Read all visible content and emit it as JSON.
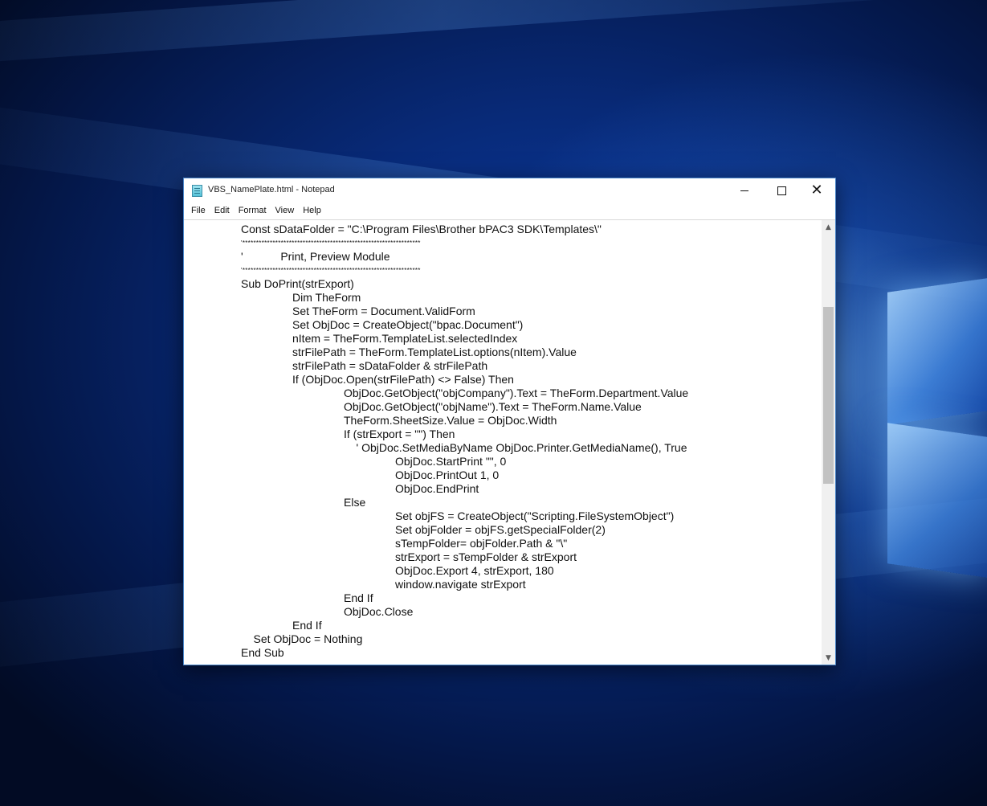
{
  "window": {
    "title": "VBS_NamePlate.html - Notepad",
    "controls": {
      "minimize": "—",
      "maximize": "☐",
      "close": "✕"
    }
  },
  "menu": {
    "items": [
      "File",
      "Edit",
      "Format",
      "View",
      "Help"
    ]
  },
  "editor": {
    "lines": [
      "Const sDataFolder = \"C:\\Program Files\\Brother bPAC3 SDK\\Templates\\\"",
      "'*****************************************************************",
      "'\t\tPrint, Preview Module",
      "'*****************************************************************",
      "Sub DoPrint(strExport)",
      "\t\tDim TheForm",
      "\t\tSet TheForm = Document.ValidForm",
      "\t\tSet ObjDoc = CreateObject(\"bpac.Document\")",
      "\t\tnItem = TheForm.TemplateList.selectedIndex",
      "\t\tstrFilePath = TheForm.TemplateList.options(nItem).Value",
      "\t\tstrFilePath = sDataFolder & strFilePath",
      "\t\tIf (ObjDoc.Open(strFilePath) <> False) Then",
      "\t\t\t\tObjDoc.GetObject(\"objCompany\").Text = TheForm.Department.Value",
      "\t\t\t\tObjDoc.GetObject(\"objName\").Text = TheForm.Name.Value",
      "\t\t\t\tTheForm.SheetSize.Value = ObjDoc.Width",
      "\t\t\t\tIf (strExport = \"\") Then",
      "\t\t\t\t    ' ObjDoc.SetMediaByName ObjDoc.Printer.GetMediaName(), True",
      "\t\t\t\t\t\tObjDoc.StartPrint \"\", 0",
      "\t\t\t\t\t\tObjDoc.PrintOut 1, 0",
      "\t\t\t\t\t\tObjDoc.EndPrint",
      "\t\t\t\tElse",
      "\t\t\t\t\t\tSet objFS = CreateObject(\"Scripting.FileSystemObject\")",
      "\t\t\t\t\t\tSet objFolder = objFS.getSpecialFolder(2)",
      "\t\t\t\t\t\tsTempFolder= objFolder.Path & \"\\\"",
      "\t\t\t\t\t\tstrExport = sTempFolder & strExport",
      "\t\t\t\t\t\tObjDoc.Export 4, strExport, 180",
      "\t\t\t\t\t\twindow.navigate strExport",
      "\t\t\t\tEnd If",
      "\t\t\t\tObjDoc.Close",
      "\t\tEnd If",
      "    Set ObjDoc = Nothing",
      "End Sub"
    ]
  },
  "scrollbar": {
    "up_glyph": "▲",
    "down_glyph": "▼",
    "position_fraction": 0.25
  },
  "colors": {
    "desktop_accent": "#0d3ea8",
    "window_border": "#4a86c8",
    "text": "#111111"
  }
}
